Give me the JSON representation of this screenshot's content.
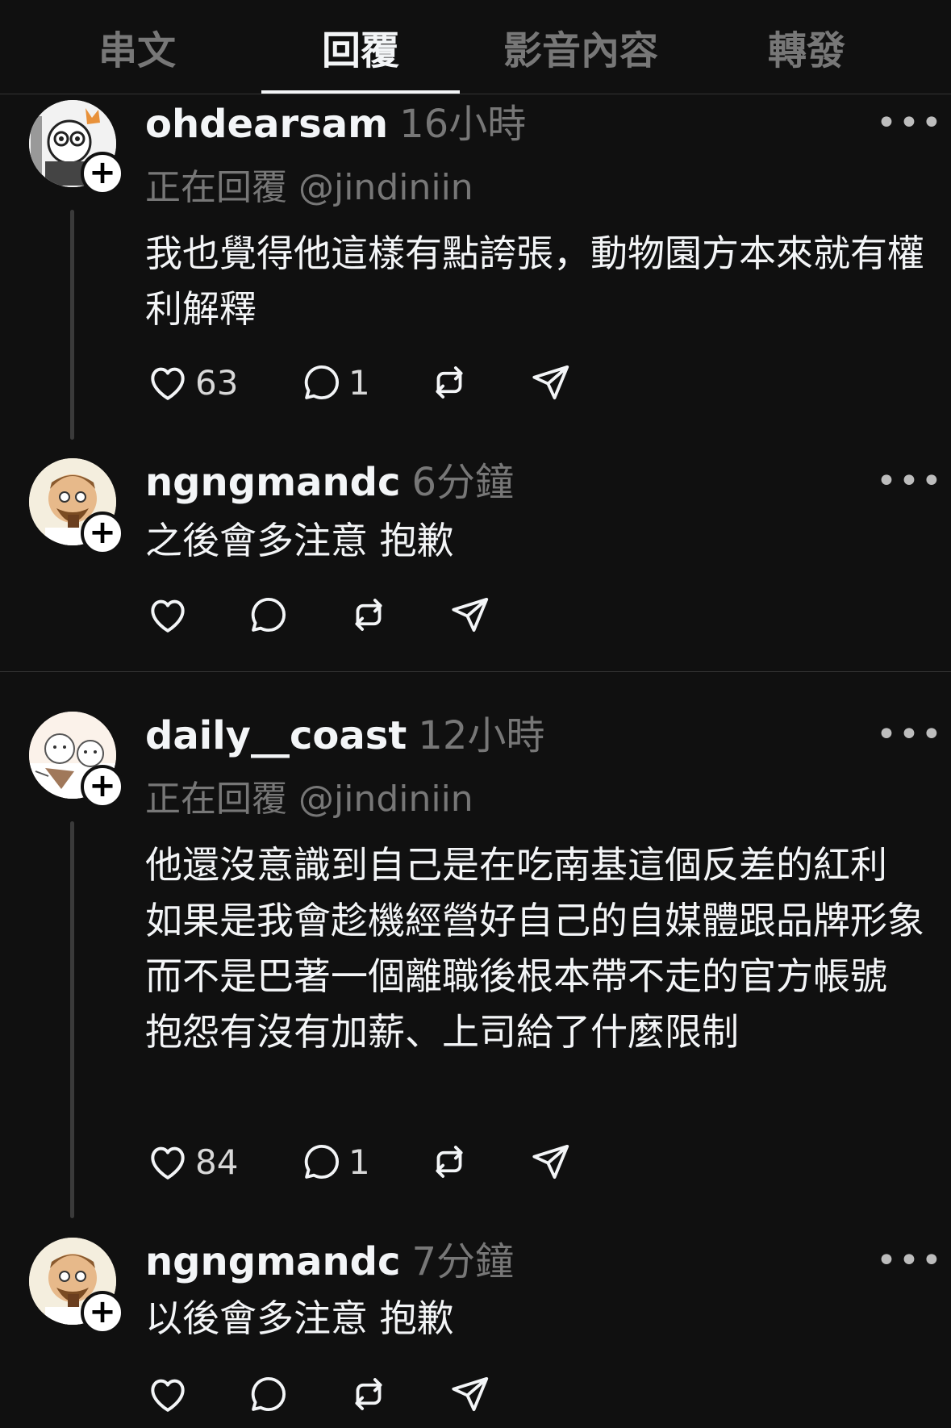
{
  "tabs": [
    {
      "label": "串文",
      "active": false
    },
    {
      "label": "回覆",
      "active": true
    },
    {
      "label": "影音內容",
      "active": false
    },
    {
      "label": "轉發",
      "active": false
    }
  ],
  "posts": [
    {
      "username": "ohdearsam",
      "time": "16小時",
      "replying_to": "正在回覆 @jindiniin",
      "text": "我也覺得他這樣有點誇張，動物園方本來就有權利解釋",
      "likes": "63",
      "replies": "1"
    },
    {
      "username": "ngngmandc",
      "time": "6分鐘",
      "text": "之後會多注意 抱歉",
      "likes": "",
      "replies": ""
    },
    {
      "username": "daily__coast",
      "time": "12小時",
      "replying_to": "正在回覆 @jindiniin",
      "text": "他還沒意識到自己是在吃南基這個反差的紅利 如果是我會趁機經營好自己的自媒體跟品牌形象 而不是巴著一個離職後根本帶不走的官方帳號 抱怨有沒有加薪、上司給了什麼限制",
      "likes": "84",
      "replies": "1"
    },
    {
      "username": "ngngmandc",
      "time": "7分鐘",
      "text": "以後會多注意 抱歉",
      "likes": "",
      "replies": ""
    }
  ],
  "icons": {
    "like": "heart-icon",
    "reply": "comment-icon",
    "repost": "repost-icon",
    "share": "send-icon",
    "more": "more-icon",
    "follow": "plus-icon"
  },
  "colors": {
    "background": "#101010",
    "text_primary": "#f3f5f7",
    "text_secondary": "#777777",
    "thread_line": "#3a3a3a"
  }
}
